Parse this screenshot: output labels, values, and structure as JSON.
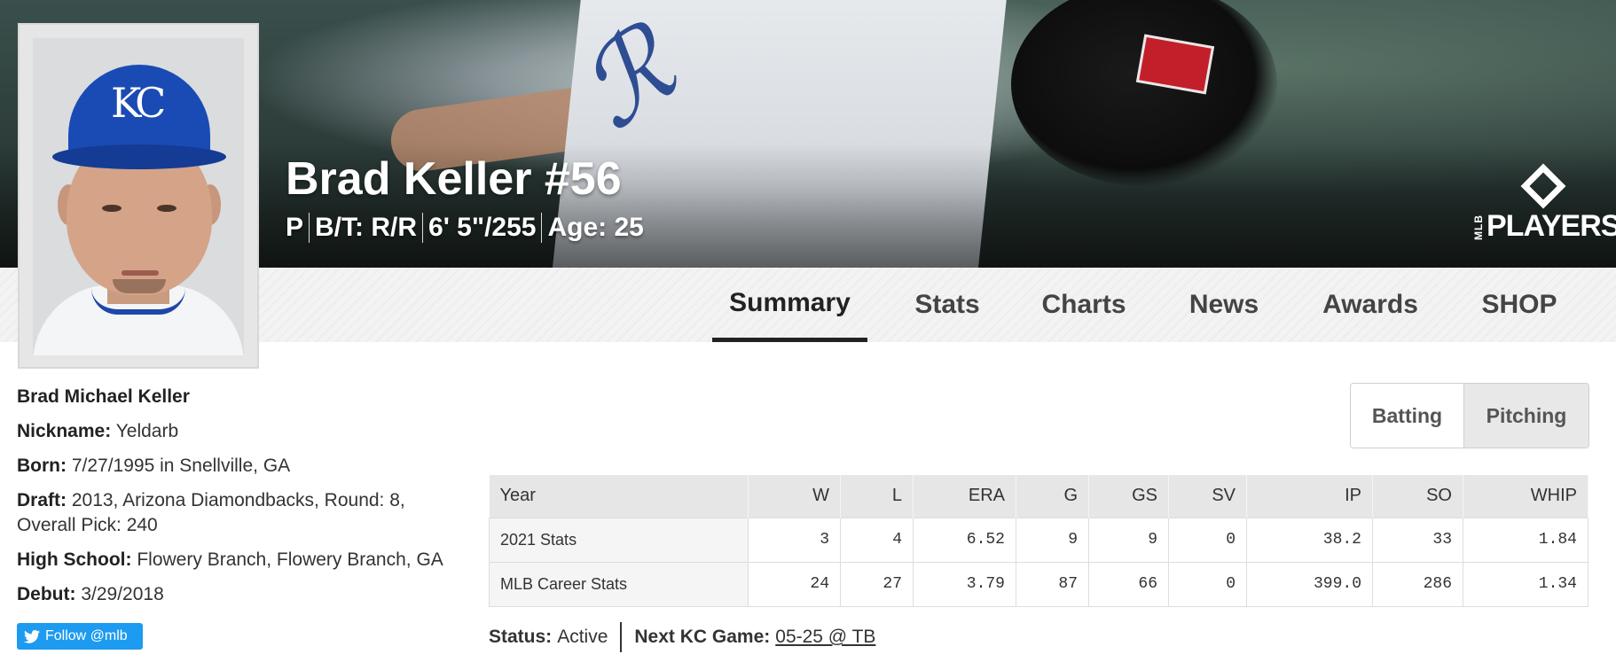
{
  "header": {
    "player_name": "Brad Keller #56",
    "position": "P",
    "bats_throws": "B/T: R/R",
    "height_weight": "6' 5\"/255",
    "age": "Age: 25",
    "logo_small": "MLB",
    "logo_text": "PLAYERS"
  },
  "nav": {
    "tabs": [
      {
        "label": "Summary",
        "active": true
      },
      {
        "label": "Stats",
        "active": false
      },
      {
        "label": "Charts",
        "active": false
      },
      {
        "label": "News",
        "active": false
      },
      {
        "label": "Awards",
        "active": false
      },
      {
        "label": "SHOP",
        "active": false
      }
    ]
  },
  "bio": {
    "full_name": "Brad Michael Keller",
    "nickname_label": "Nickname:",
    "nickname": "Yeldarb",
    "born_label": "Born:",
    "born": "7/27/1995 in Snellville, GA",
    "draft_label": "Draft:",
    "draft": "2013, Arizona Diamondbacks, Round: 8, Overall Pick: 240",
    "high_school_label": "High School:",
    "high_school": "Flowery Branch, Flowery Branch, GA",
    "debut_label": "Debut:",
    "debut": "3/29/2018",
    "follow_button": "Follow @mlb"
  },
  "toggle": {
    "batting": "Batting",
    "pitching": "Pitching",
    "selected": "Pitching"
  },
  "stats_table": {
    "columns": [
      "Year",
      "W",
      "L",
      "ERA",
      "G",
      "GS",
      "SV",
      "IP",
      "SO",
      "WHIP"
    ],
    "rows": [
      [
        "2021 Stats",
        "3",
        "4",
        "6.52",
        "9",
        "9",
        "0",
        "38.2",
        "33",
        "1.84"
      ],
      [
        "MLB Career Stats",
        "24",
        "27",
        "3.79",
        "87",
        "66",
        "0",
        "399.0",
        "286",
        "1.34"
      ]
    ]
  },
  "status": {
    "status_label": "Status:",
    "status_value": "Active",
    "next_game_label": "Next KC Game:",
    "next_game_value": "05-25 @ TB"
  },
  "colors": {
    "twitter_blue": "#1d9bf0",
    "royals_blue": "#1a4bb5",
    "nav_active": "#222222"
  }
}
